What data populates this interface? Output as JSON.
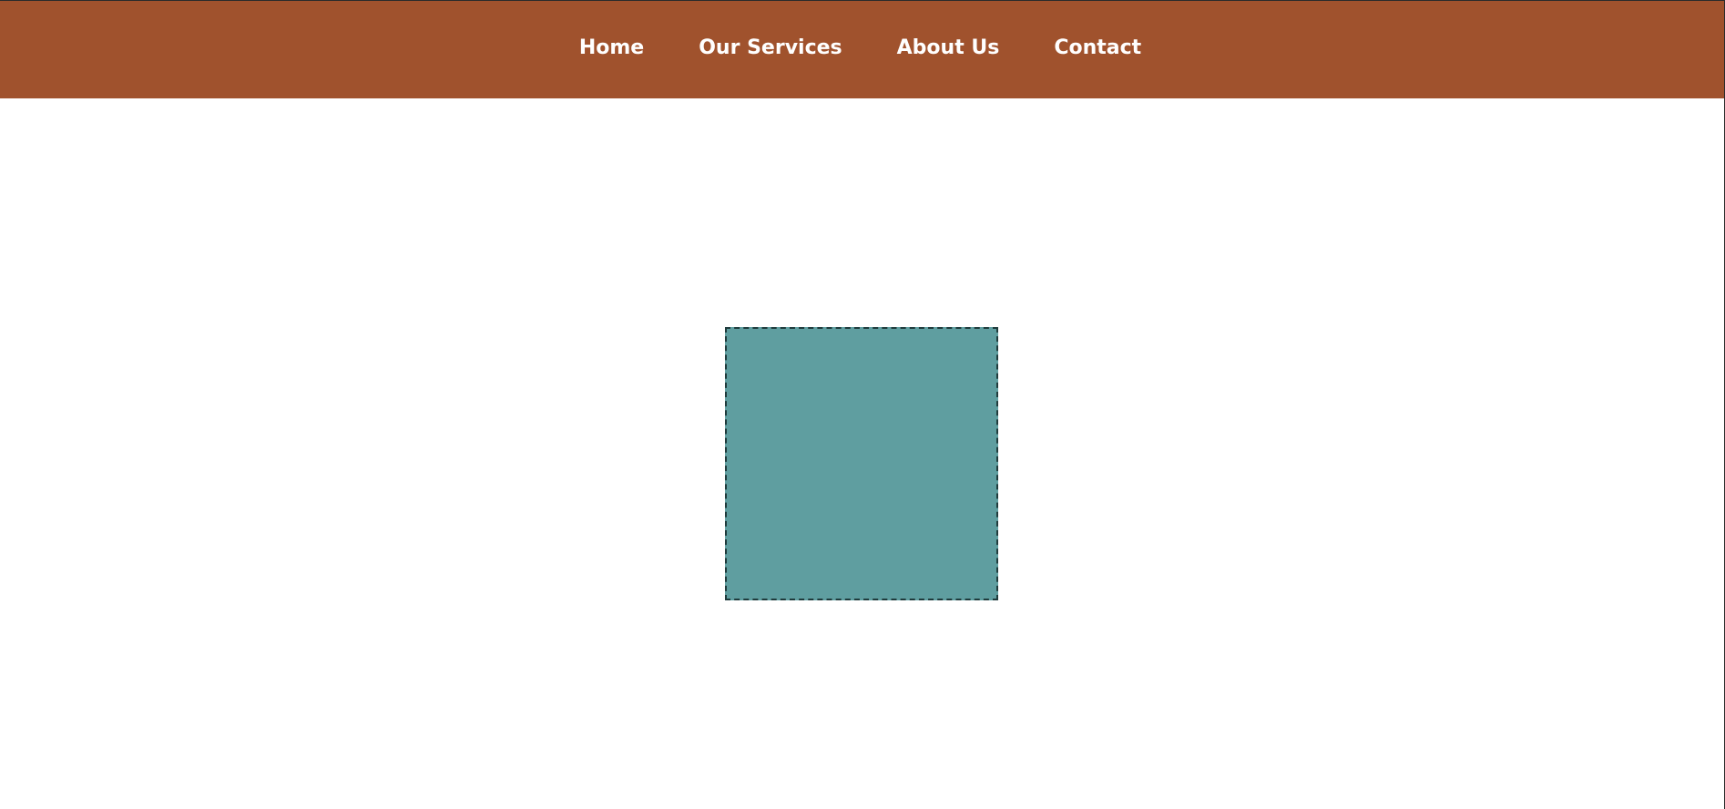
{
  "nav": {
    "items": [
      {
        "label": "Home"
      },
      {
        "label": "Our Services"
      },
      {
        "label": "About Us"
      },
      {
        "label": "Contact"
      }
    ]
  },
  "colors": {
    "navbar_background": "#a0522d",
    "nav_text": "#ffffff",
    "page_background": "#ffffff",
    "box_fill": "#5f9ea0",
    "box_border": "#1f3b3c"
  }
}
